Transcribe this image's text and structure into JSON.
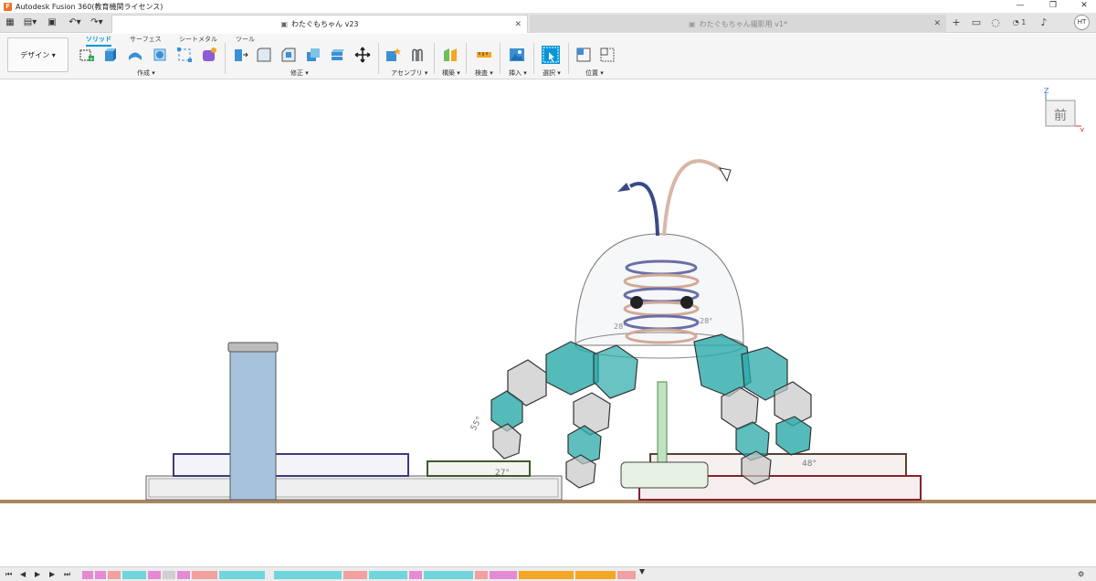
{
  "titlebar": {
    "app_title": "Autodesk Fusion 360(教育機関ライセンス)"
  },
  "tabs": [
    {
      "label": "わたぐもちゃん v23",
      "active": true
    },
    {
      "label": "わたぐもちゃん撮影用 v1*",
      "active": false
    }
  ],
  "quick_access": {
    "job_count": "1",
    "user_initials": "HT"
  },
  "workspace": {
    "label": "デザイン ▾"
  },
  "ribbon_tabs": [
    "ソリッド",
    "サーフェス",
    "シートメタル",
    "ツール"
  ],
  "ribbon_groups": [
    {
      "label": "作成 ▾"
    },
    {
      "label": "修正 ▾"
    },
    {
      "label": "アセンブリ ▾"
    },
    {
      "label": "構築 ▾"
    },
    {
      "label": "検査 ▾"
    },
    {
      "label": "挿入 ▾"
    },
    {
      "label": "選択 ▾"
    },
    {
      "label": "位置 ▾"
    }
  ],
  "viewcube": {
    "face_label": "前",
    "z_label": "Z",
    "x_label": "X"
  },
  "dimensions": {
    "left_angle": "55°",
    "bottom_dim": "27°",
    "right_angle": "48°",
    "head_left": "28°",
    "head_right": "28°"
  },
  "colors": {
    "accent": "#0696d7",
    "teal": "#2aa9a9",
    "shelf": "#a8875f",
    "mug": "#a7c3dc"
  },
  "icons": [
    "grid-icon",
    "file-icon",
    "save-icon",
    "undo-icon",
    "redo-icon",
    "add-tab-icon",
    "chat-icon",
    "sync-icon",
    "job-icon",
    "bell-icon"
  ]
}
